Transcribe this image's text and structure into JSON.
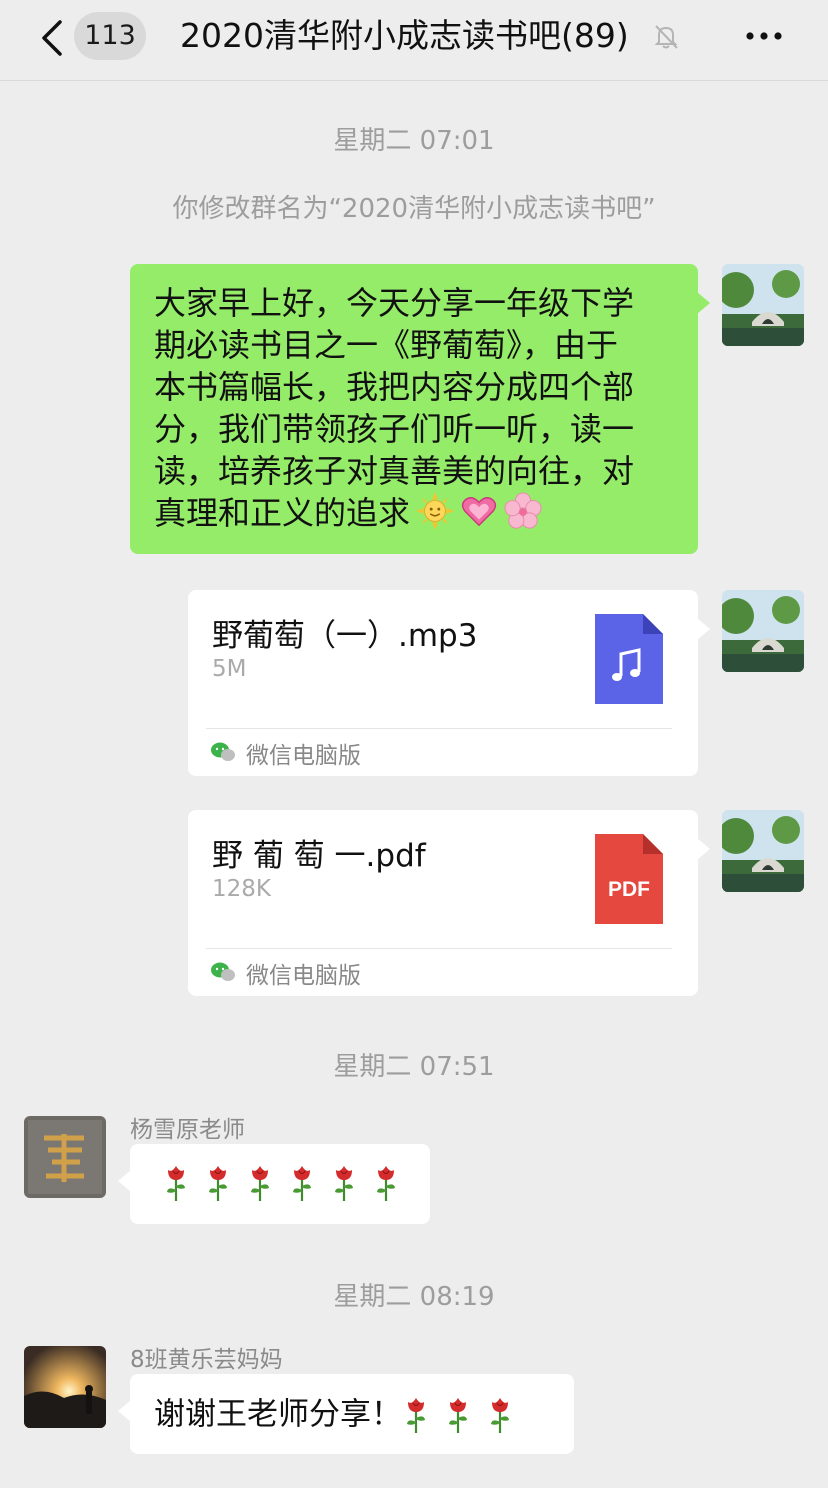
{
  "header": {
    "back_label": "<",
    "unread_count": "113",
    "title": "2020清华附小成志读书吧(89)",
    "mute_icon": "bell-slash-icon",
    "more_icon": "ellipsis-icon"
  },
  "messages": {
    "time_1": "星期二 07:01",
    "system_1": "你修改群名为“2020清华附小成志读书吧”",
    "greeting": {
      "line1": "大家早上好，今天分享一年级下学",
      "line2": "期必读书目之一《野葡萄》，由于",
      "line3": "本书篇幅长，我把内容分成四个部",
      "line4": "分，我们带领孩子们听一听，读一",
      "line5": "读，培养孩子对真善美的向往，对",
      "line6": "真理和正义的追求",
      "emojis": [
        "sun-face-icon",
        "heart-icon",
        "cherry-blossom-icon"
      ]
    },
    "file_mp3": {
      "name": "野葡萄（一）.mp3",
      "size": "5M",
      "source": "微信电脑版",
      "icon": "music-file-icon"
    },
    "file_pdf": {
      "name": "野 葡 萄 一.pdf",
      "size": "128K",
      "source": "微信电脑版",
      "icon_label": "PDF"
    },
    "time_2": "星期二 07:51",
    "yang": {
      "sender": "杨雪原老师",
      "roses": 6
    },
    "time_3": "星期二 08:19",
    "huang": {
      "sender": "8班黄乐芸妈妈",
      "text": "谢谢王老师分享！",
      "roses": 3
    }
  },
  "colors": {
    "background": "#ededed",
    "self_bubble": "#95ec69",
    "other_bubble": "#ffffff",
    "mp3_icon": "#5b63e6",
    "pdf_icon": "#e5483f"
  }
}
